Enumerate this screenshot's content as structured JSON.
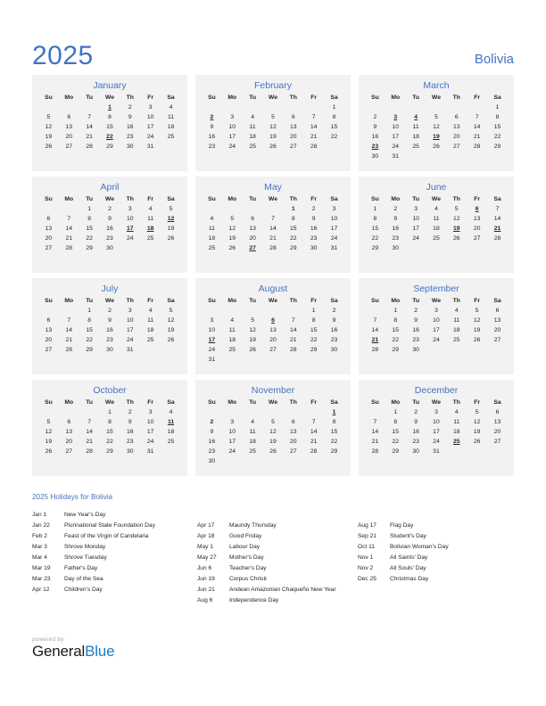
{
  "header": {
    "year": "2025",
    "country": "Bolivia",
    "accent_color": "#4472c4",
    "holiday_color": "#e00000"
  },
  "weekday_headers": [
    "Su",
    "Mo",
    "Tu",
    "We",
    "Th",
    "Fr",
    "Sa"
  ],
  "months": [
    {
      "name": "January",
      "lead_blanks": 3,
      "days": 31,
      "holidays_underlined": [
        1,
        22
      ],
      "holidays_plain": []
    },
    {
      "name": "February",
      "lead_blanks": 6,
      "days": 28,
      "holidays_underlined": [
        2
      ],
      "holidays_plain": []
    },
    {
      "name": "March",
      "lead_blanks": 6,
      "days": 31,
      "holidays_underlined": [
        3,
        4,
        19,
        23
      ],
      "holidays_plain": []
    },
    {
      "name": "April",
      "lead_blanks": 2,
      "days": 30,
      "holidays_underlined": [
        12,
        17,
        18
      ],
      "holidays_plain": []
    },
    {
      "name": "May",
      "lead_blanks": 4,
      "days": 31,
      "holidays_underlined": [
        27
      ],
      "holidays_plain": [
        1
      ]
    },
    {
      "name": "June",
      "lead_blanks": 0,
      "days": 30,
      "holidays_underlined": [
        6,
        19,
        21
      ],
      "holidays_plain": []
    },
    {
      "name": "July",
      "lead_blanks": 2,
      "days": 31,
      "holidays_underlined": [],
      "holidays_plain": []
    },
    {
      "name": "August",
      "lead_blanks": 5,
      "days": 31,
      "holidays_underlined": [
        6,
        17
      ],
      "holidays_plain": []
    },
    {
      "name": "September",
      "lead_blanks": 1,
      "days": 30,
      "holidays_underlined": [
        21
      ],
      "holidays_plain": []
    },
    {
      "name": "October",
      "lead_blanks": 3,
      "days": 31,
      "holidays_underlined": [
        11
      ],
      "holidays_plain": []
    },
    {
      "name": "November",
      "lead_blanks": 6,
      "days": 30,
      "holidays_underlined": [
        1
      ],
      "holidays_plain": [
        2
      ]
    },
    {
      "name": "December",
      "lead_blanks": 1,
      "days": 31,
      "holidays_underlined": [
        25
      ],
      "holidays_plain": []
    }
  ],
  "holidays_section": {
    "title": "2025 Holidays for Bolivia",
    "columns": [
      {
        "entries": [
          {
            "date": "Jan 1",
            "name": "New Year's Day"
          },
          {
            "date": "Jan 22",
            "name": "Plurinational State Foundation Day"
          },
          {
            "date": "Feb 2",
            "name": "Feast of the Virgin of Candelaria"
          },
          {
            "date": "Mar 3",
            "name": "Shrove Monday"
          },
          {
            "date": "Mar 4",
            "name": "Shrove Tuesday"
          },
          {
            "date": "Mar 19",
            "name": "Father's Day"
          },
          {
            "date": "Mar 23",
            "name": "Day of the Sea"
          },
          {
            "date": "Apr 12",
            "name": "Children's Day"
          }
        ],
        "top_spacer": false
      },
      {
        "entries": [
          {
            "date": "Apr 17",
            "name": "Maundy Thursday"
          },
          {
            "date": "Apr 18",
            "name": "Good Friday"
          },
          {
            "date": "May 1",
            "name": "Labour Day"
          },
          {
            "date": "May 27",
            "name": "Mother's Day"
          },
          {
            "date": "Jun 6",
            "name": "Teacher's Day"
          },
          {
            "date": "Jun 19",
            "name": "Corpus Christi"
          },
          {
            "date": "Jun 21",
            "name": "Andean Amazonian Chaqueño New Year"
          },
          {
            "date": "Aug 6",
            "name": "Independence Day"
          }
        ],
        "top_spacer": true
      },
      {
        "entries": [
          {
            "date": "Aug 17",
            "name": "Flag Day"
          },
          {
            "date": "Sep 21",
            "name": "Student's Day"
          },
          {
            "date": "Oct 11",
            "name": "Bolivian Woman's Day"
          },
          {
            "date": "Nov 1",
            "name": "All Saints' Day"
          },
          {
            "date": "Nov 2",
            "name": "All Souls' Day"
          },
          {
            "date": "Dec 25",
            "name": "Christmas Day"
          }
        ],
        "top_spacer": true
      }
    ]
  },
  "footer": {
    "powered_by": "powered by",
    "brand_first": "General",
    "brand_second": "Blue"
  }
}
